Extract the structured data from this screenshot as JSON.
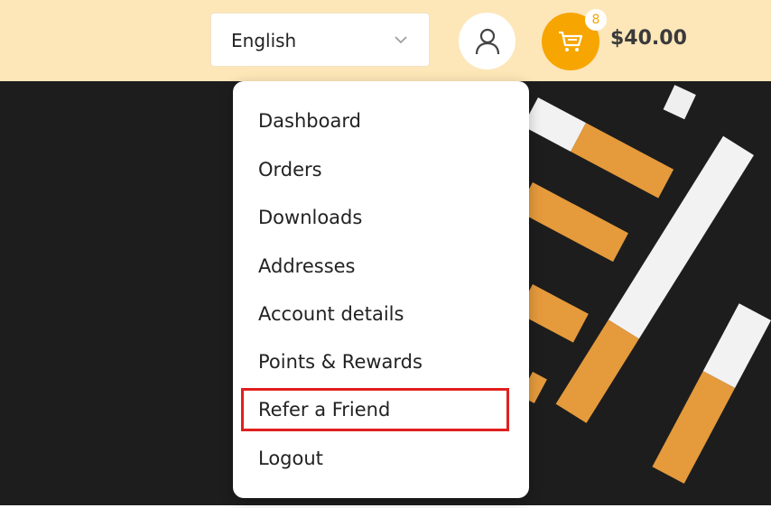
{
  "header": {
    "language": "English",
    "cart": {
      "count": "8",
      "total": "$40.00"
    }
  },
  "account_menu": {
    "items": [
      "Dashboard",
      "Orders",
      "Downloads",
      "Addresses",
      "Account details",
      "Points & Rewards",
      "Refer a Friend",
      "Logout"
    ],
    "highlighted_item": "Refer a Friend"
  },
  "colors": {
    "topbar_bg": "#fde6b8",
    "cart_accent": "#f7a500",
    "highlight_border": "#e0201f",
    "hero_bg": "#1d1d1d"
  },
  "icons": {
    "language_chevron": "chevron-down-icon",
    "account": "user-icon",
    "cart": "cart-icon"
  }
}
